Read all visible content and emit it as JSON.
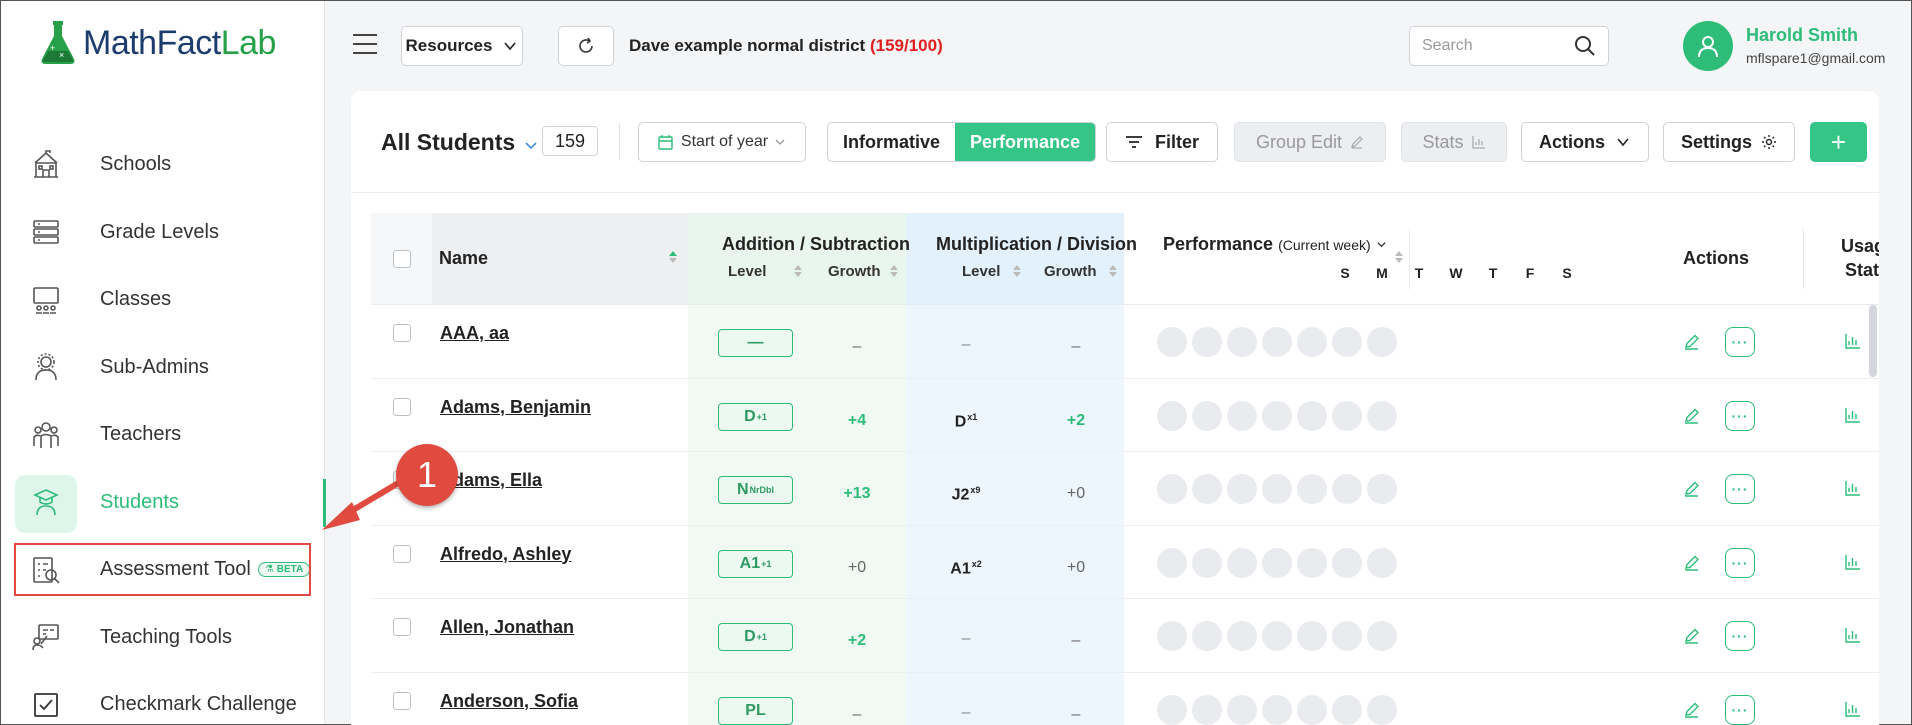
{
  "brand": {
    "math": "Math",
    "fact": "Fact",
    "lab": "Lab"
  },
  "colors": {
    "accent": "#2dbd78",
    "callout": "#e04a3f",
    "count_red": "#e02020"
  },
  "sidebar": {
    "items": [
      {
        "label": "Schools",
        "icon": "school-icon"
      },
      {
        "label": "Grade Levels",
        "icon": "grade-levels-icon"
      },
      {
        "label": "Classes",
        "icon": "classes-icon"
      },
      {
        "label": "Sub-Admins",
        "icon": "sub-admins-icon"
      },
      {
        "label": "Teachers",
        "icon": "teachers-icon"
      },
      {
        "label": "Students",
        "icon": "students-icon",
        "active": true
      },
      {
        "label": "Assessment Tool",
        "icon": "assessment-icon",
        "badge": "BETA"
      },
      {
        "label": "Teaching Tools",
        "icon": "teaching-tools-icon"
      },
      {
        "label": "Checkmark Challenge",
        "icon": "checkmark-icon"
      }
    ]
  },
  "topbar": {
    "resources_label": "Resources",
    "district_name": "Dave example normal district",
    "district_count": "(159/100)",
    "search_placeholder": "Search",
    "user_name": "Harold Smith",
    "user_email": "mflspare1@gmail.com"
  },
  "toolbar": {
    "title": "All Students",
    "count": "159",
    "period": "Start of year",
    "mode_informative": "Informative",
    "mode_performance": "Performance",
    "filter": "Filter",
    "group_edit": "Group Edit",
    "stats": "Stats",
    "actions": "Actions",
    "settings": "Settings",
    "add": "+"
  },
  "table": {
    "headers": {
      "name": "Name",
      "add_sub": "Addition / Subtraction",
      "mul_div": "Multiplication / Division",
      "level": "Level",
      "growth": "Growth",
      "performance": "Performance",
      "performance_note": "(Current week)",
      "actions": "Actions",
      "usage_1": "Usag",
      "usage_2": "Stat"
    },
    "days": [
      "S",
      "M",
      "T",
      "W",
      "T",
      "F",
      "S"
    ],
    "rows": [
      {
        "name": "AAA, aa",
        "as_level": "—",
        "as_sup": "",
        "as_growth": "–",
        "md_level": "–",
        "md_sup": "",
        "md_growth": "–"
      },
      {
        "name": "Adams, Benjamin",
        "as_level": "D",
        "as_sup": "+1",
        "as_growth": "+4",
        "md_level": "D",
        "md_sup": "x1",
        "md_growth": "+2"
      },
      {
        "name": "Adams, Ella",
        "as_level": "N",
        "as_sup": "NrDbl",
        "as_growth": "+13",
        "md_level": "J2",
        "md_sup": "x9",
        "md_growth": "+0"
      },
      {
        "name": "Alfredo, Ashley",
        "as_level": "A1",
        "as_sup": "+1",
        "as_growth": "+0",
        "md_level": "A1",
        "md_sup": "x2",
        "md_growth": "+0"
      },
      {
        "name": "Allen, Jonathan",
        "as_level": "D",
        "as_sup": "+1",
        "as_growth": "+2",
        "md_level": "–",
        "md_sup": "",
        "md_growth": "–"
      },
      {
        "name": "Anderson, Sofia",
        "as_level": "PL",
        "as_sup": "",
        "as_growth": "–",
        "md_level": "–",
        "md_sup": "",
        "md_growth": "–"
      }
    ]
  },
  "callout": {
    "number": "1"
  }
}
